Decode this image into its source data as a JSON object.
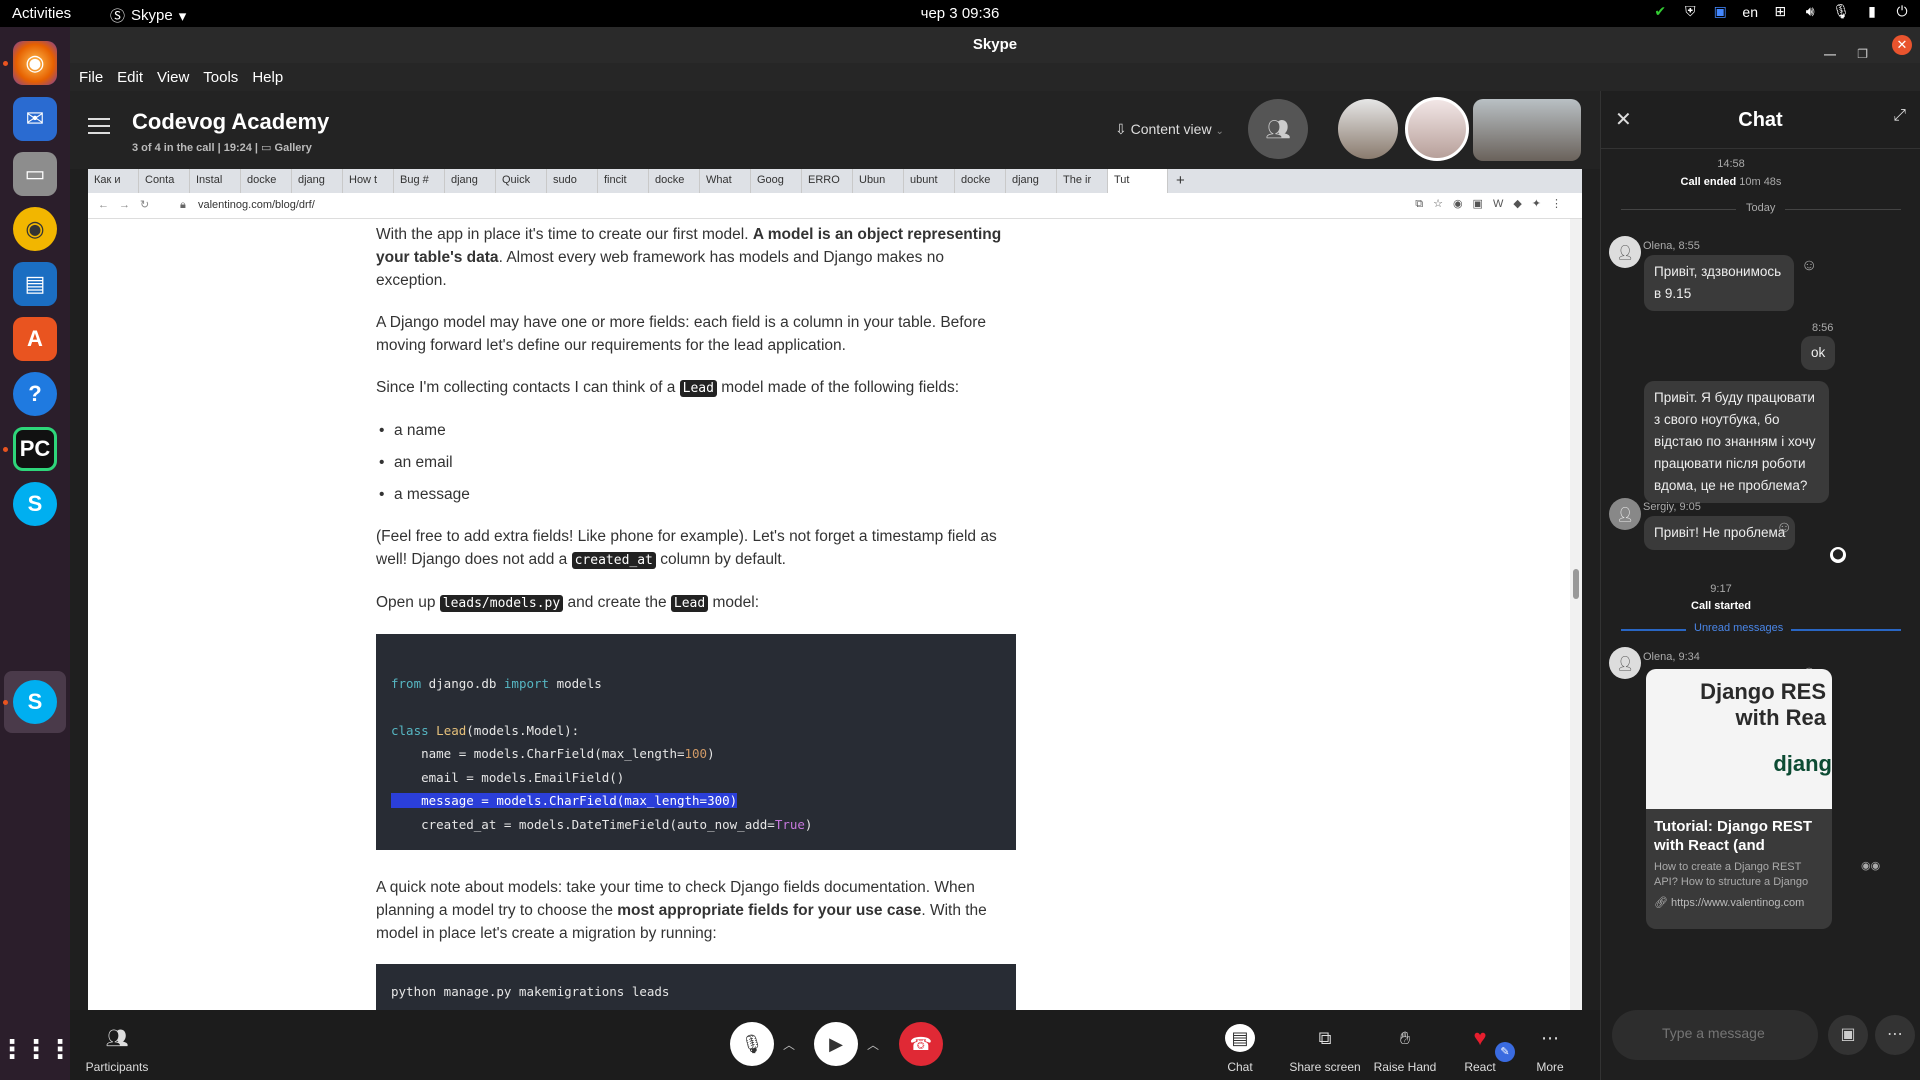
{
  "os": {
    "activities": "Activities",
    "app_name": "Skype",
    "clock": "чер 3  09:36",
    "lang": "en"
  },
  "window": {
    "title": "Skype"
  },
  "menu": [
    "File",
    "Edit",
    "View",
    "Tools",
    "Help"
  ],
  "call": {
    "title": "Codevog Academy",
    "subtitle": "3 of 4 in the call | 19:24 |",
    "view_mode": "Gallery",
    "content_view": "Content view"
  },
  "browser": {
    "tabs": [
      "Как и",
      "Conta",
      "Instal",
      "docke",
      "djang",
      "How t",
      "Bug #",
      "djang",
      "Quick",
      "sudo",
      "fincit",
      "docke",
      "What",
      "Goog",
      "ERRO",
      "Ubun",
      "ubunt",
      "docke",
      "djang",
      "The ir",
      "Tut"
    ],
    "url": "valentinog.com/blog/drf/",
    "article": {
      "p1_a": "With the app in place it's time to create our first model. ",
      "p1_b": "A model is an object representing your table's data",
      "p1_c": ". Almost every web framework has models and Django makes no exception.",
      "p2": "A Django model may have one or more fields: each field is a column in your table. Before moving forward let's define our requirements for the lead application.",
      "p3_a": "Since I'm collecting contacts I can think of a ",
      "p3_code": "Lead",
      "p3_b": " model made of the following fields:",
      "bullets": [
        "a name",
        "an email",
        "a message"
      ],
      "p4_a": "(Feel free to add extra fields! Like phone for example). Let's not forget a timestamp field as well! Django does not add a ",
      "p4_code": "created_at",
      "p4_b": " column by default.",
      "p5_a": "Open up ",
      "p5_code1": "leads/models.py",
      "p5_b": " and create the ",
      "p5_code2": "Lead",
      "p5_c": " model:",
      "p6_a": "A quick note about models: take your time to check Django fields documentation. When planning a model try to choose the ",
      "p6_b": "most appropriate fields for your use case",
      "p6_c": ". With the model in place let's create a migration by running:",
      "cmd": "python manage.py makemigrations leads",
      "code": {
        "l1_kw1": "from",
        "l1_mid": " django.db ",
        "l1_kw2": "import",
        "l1_end": " models",
        "l2_kw": "class",
        "l2_name": " Lead",
        "l2_end": "(models.Model):",
        "l3_a": "    name = models.CharField(max_length=",
        "l3_num": "100",
        "l3_b": ")",
        "l4": "    email = models.EmailField()",
        "l5": "    message = models.CharField(max_length=300)",
        "l6_a": "    created_at = models.DateTimeField(auto_now_add=",
        "l6_t": "True",
        "l6_b": ")"
      }
    }
  },
  "callbar": {
    "participants": "Participants",
    "chat": "Chat",
    "share": "Share screen",
    "raise": "Raise Hand",
    "react": "React",
    "more": "More"
  },
  "chat": {
    "title": "Chat",
    "call_ended_time": "14:58",
    "call_ended": "Call ended",
    "call_ended_dur": "10m 48s",
    "today": "Today",
    "m1_meta": "Olena, 8:55",
    "m1": "Привіт, здзвонимось в 9.15",
    "m2_time": "8:56",
    "m2": "ok",
    "m3": "Привіт. Я буду працювати з свого ноутбука, бо відстаю по знанням і хочу працювати після роботи вдома, це не проблема?",
    "m4_meta": "Sergiy, 9:05",
    "m4": "Привіт! Не проблема",
    "call_started_time": "9:17",
    "call_started": "Call started",
    "unread": "Unread messages",
    "m5_meta": "Olena, 9:34",
    "card_img_l1": "Django RES",
    "card_img_l2": "with Rea",
    "card_img_l3": "djang",
    "card_title": "Tutorial: Django REST with React (and",
    "card_desc": "How to create a Django REST API? How to structure a Django",
    "card_link": "https://www.valentinog.com",
    "input_placeholder": "Type a message"
  }
}
